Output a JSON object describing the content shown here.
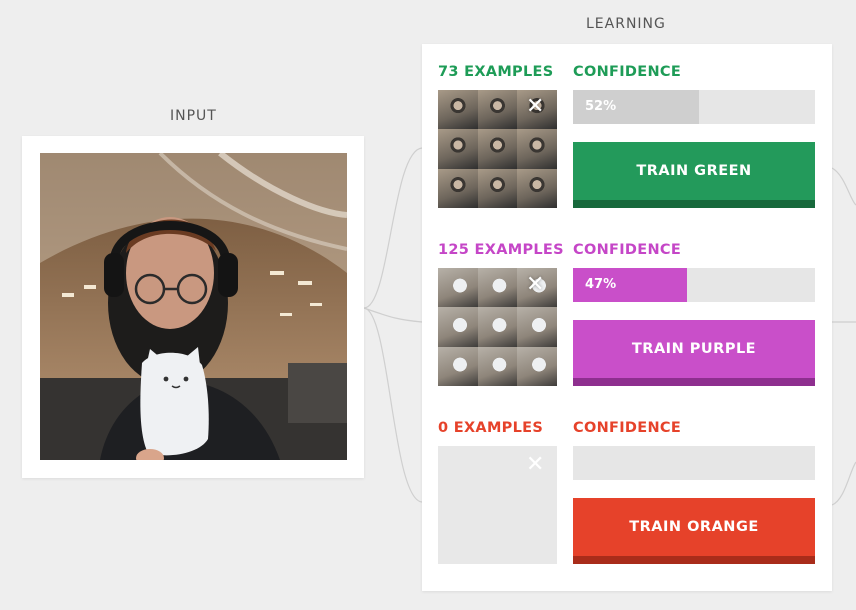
{
  "input": {
    "label": "INPUT"
  },
  "learning": {
    "label": "LEARNING"
  },
  "classes": [
    {
      "examples_label": "73 EXAMPLES",
      "confidence_label": "CONFIDENCE",
      "confidence_value": "52%",
      "confidence_fraction": 0.52,
      "train_label": "TRAIN GREEN",
      "color": "#1e9c57",
      "button_color": "#239a5b",
      "button_shadow": "#17693c",
      "bar_fill_color": "#cfcfcf",
      "has_examples": true
    },
    {
      "examples_label": "125 EXAMPLES",
      "confidence_label": "CONFIDENCE",
      "confidence_value": "47%",
      "confidence_fraction": 0.47,
      "train_label": "TRAIN PURPLE",
      "color": "#c546c7",
      "button_color": "#c94fc9",
      "button_shadow": "#8e2f8f",
      "bar_fill_color": "#c94fc9",
      "has_examples": true
    },
    {
      "examples_label": "0 EXAMPLES",
      "confidence_label": "CONFIDENCE",
      "confidence_value": "",
      "confidence_fraction": 0,
      "train_label": "TRAIN ORANGE",
      "color": "#e6422a",
      "button_color": "#e6422a",
      "button_shadow": "#a92c1a",
      "bar_fill_color": "#e6422a",
      "has_examples": false
    }
  ],
  "icons": {
    "clear": "close-icon"
  }
}
